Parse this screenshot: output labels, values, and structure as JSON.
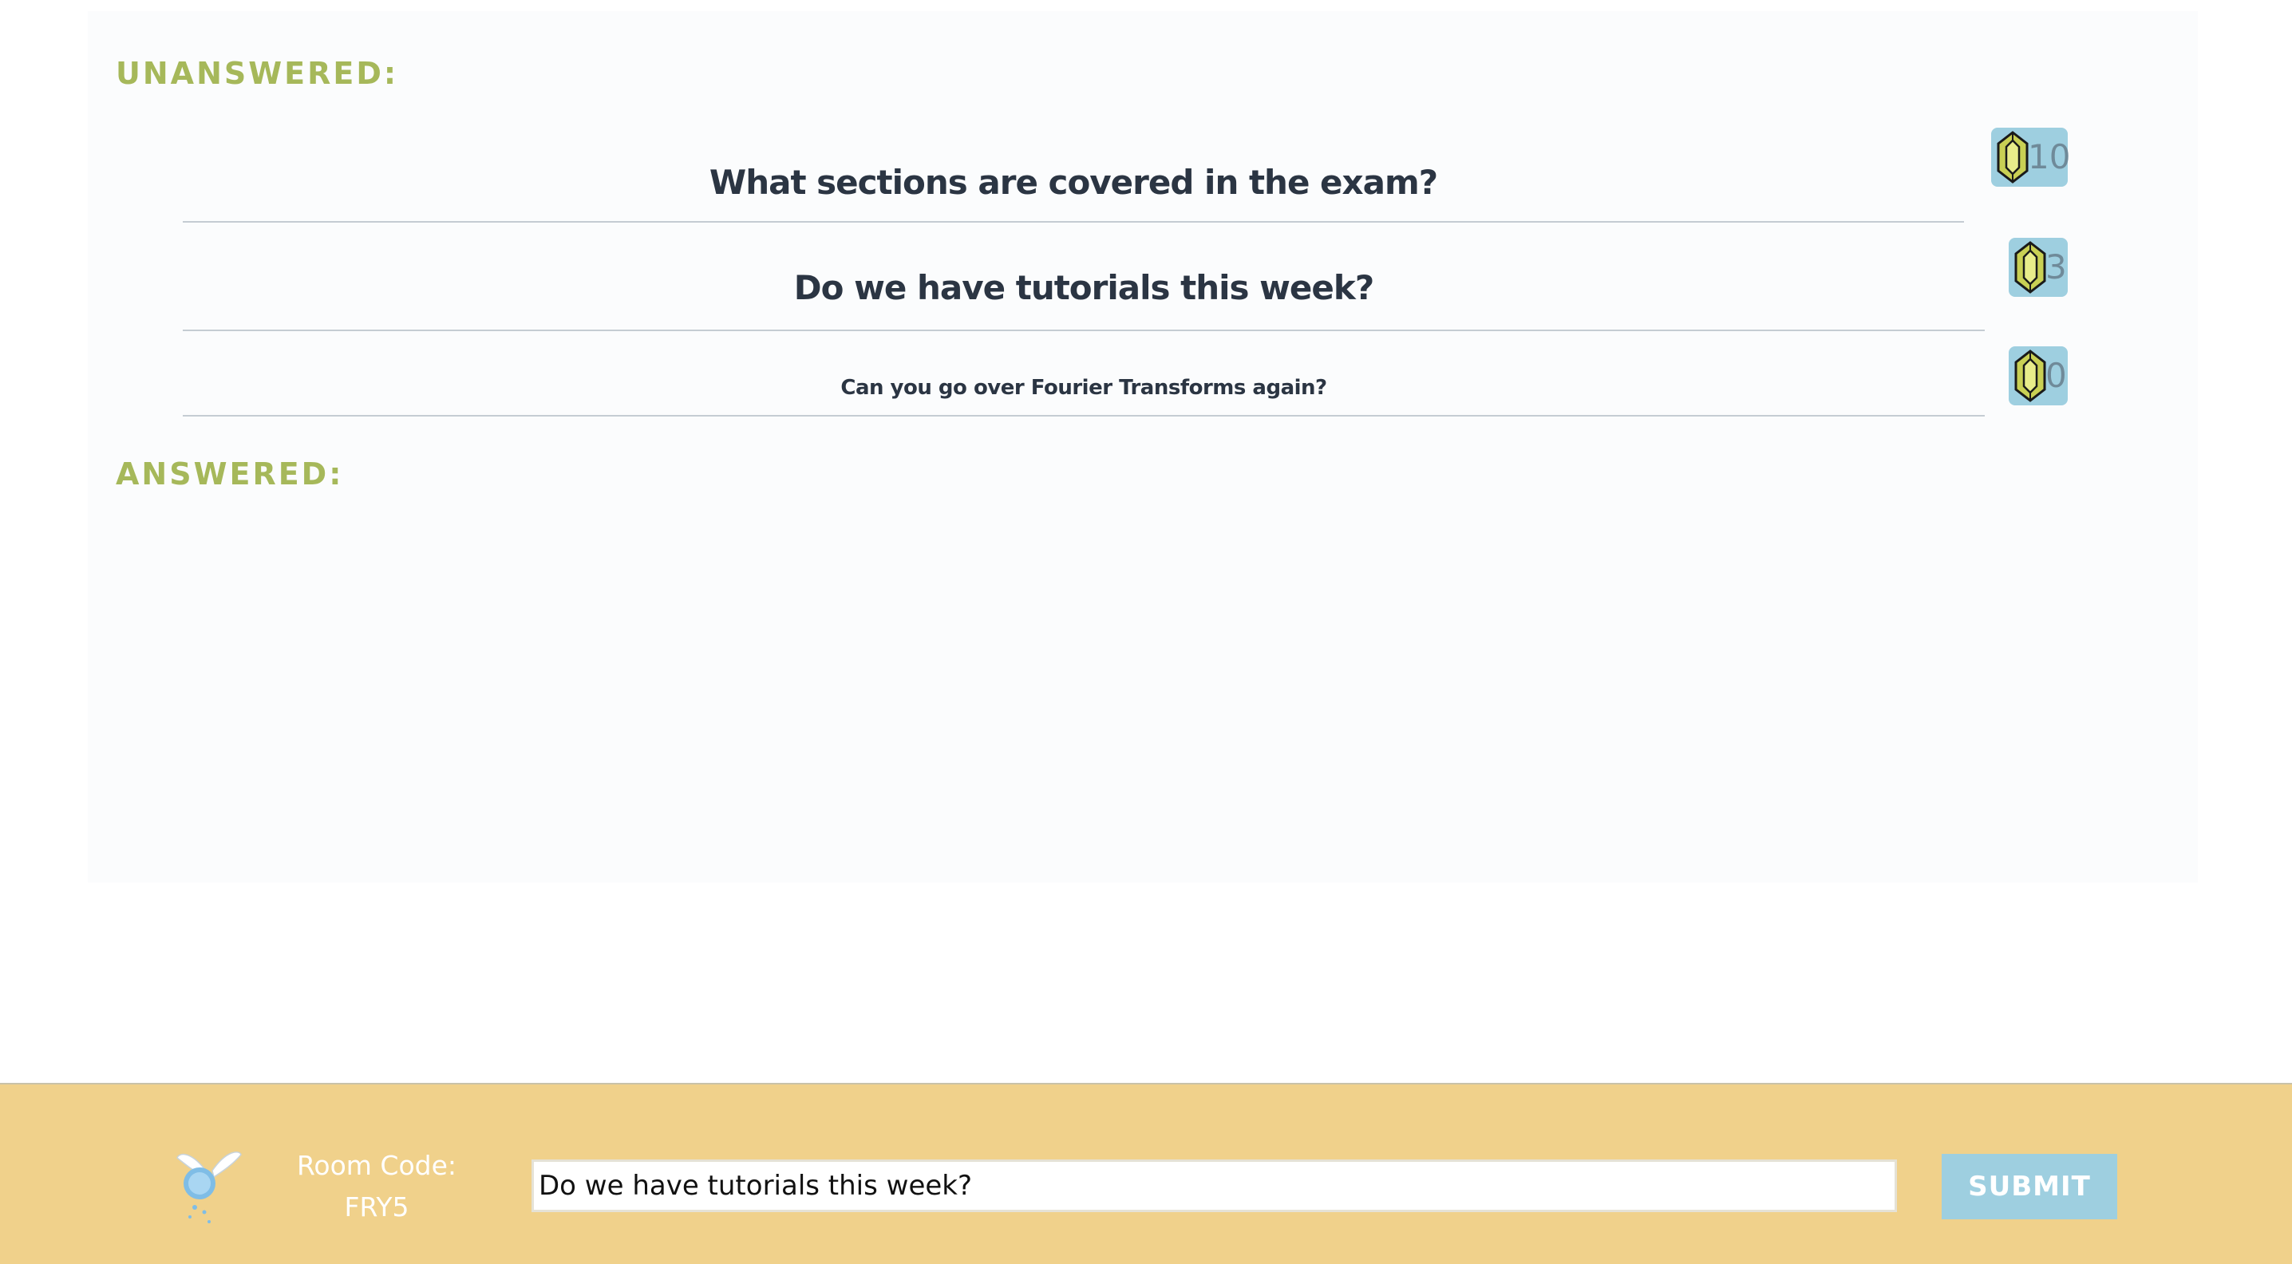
{
  "sections": {
    "unanswered_heading": "UNANSWERED:",
    "answered_heading": "ANSWERED:"
  },
  "questions": [
    {
      "text": "What sections are covered in the exam?",
      "votes": "10",
      "vote_icon": "rupee-gem-icon"
    },
    {
      "text": "Do we have tutorials this week?",
      "votes": "3",
      "vote_icon": "rupee-gem-icon"
    },
    {
      "text": "Can you go over Fourier Transforms again?",
      "votes": "0",
      "vote_icon": "rupee-gem-icon"
    }
  ],
  "answered": [],
  "footer": {
    "mascot_icon": "fairy-icon",
    "room_label": "Room Code:",
    "room_code": "FRY5",
    "input_value": "Do we have tutorials this week?",
    "submit_label": "SUBMIT"
  },
  "colors": {
    "heading_green": "#a6b85a",
    "footer_yellow": "#f0d18b",
    "accent_blue": "#9ecfe0",
    "text_dark": "#2b3543"
  }
}
